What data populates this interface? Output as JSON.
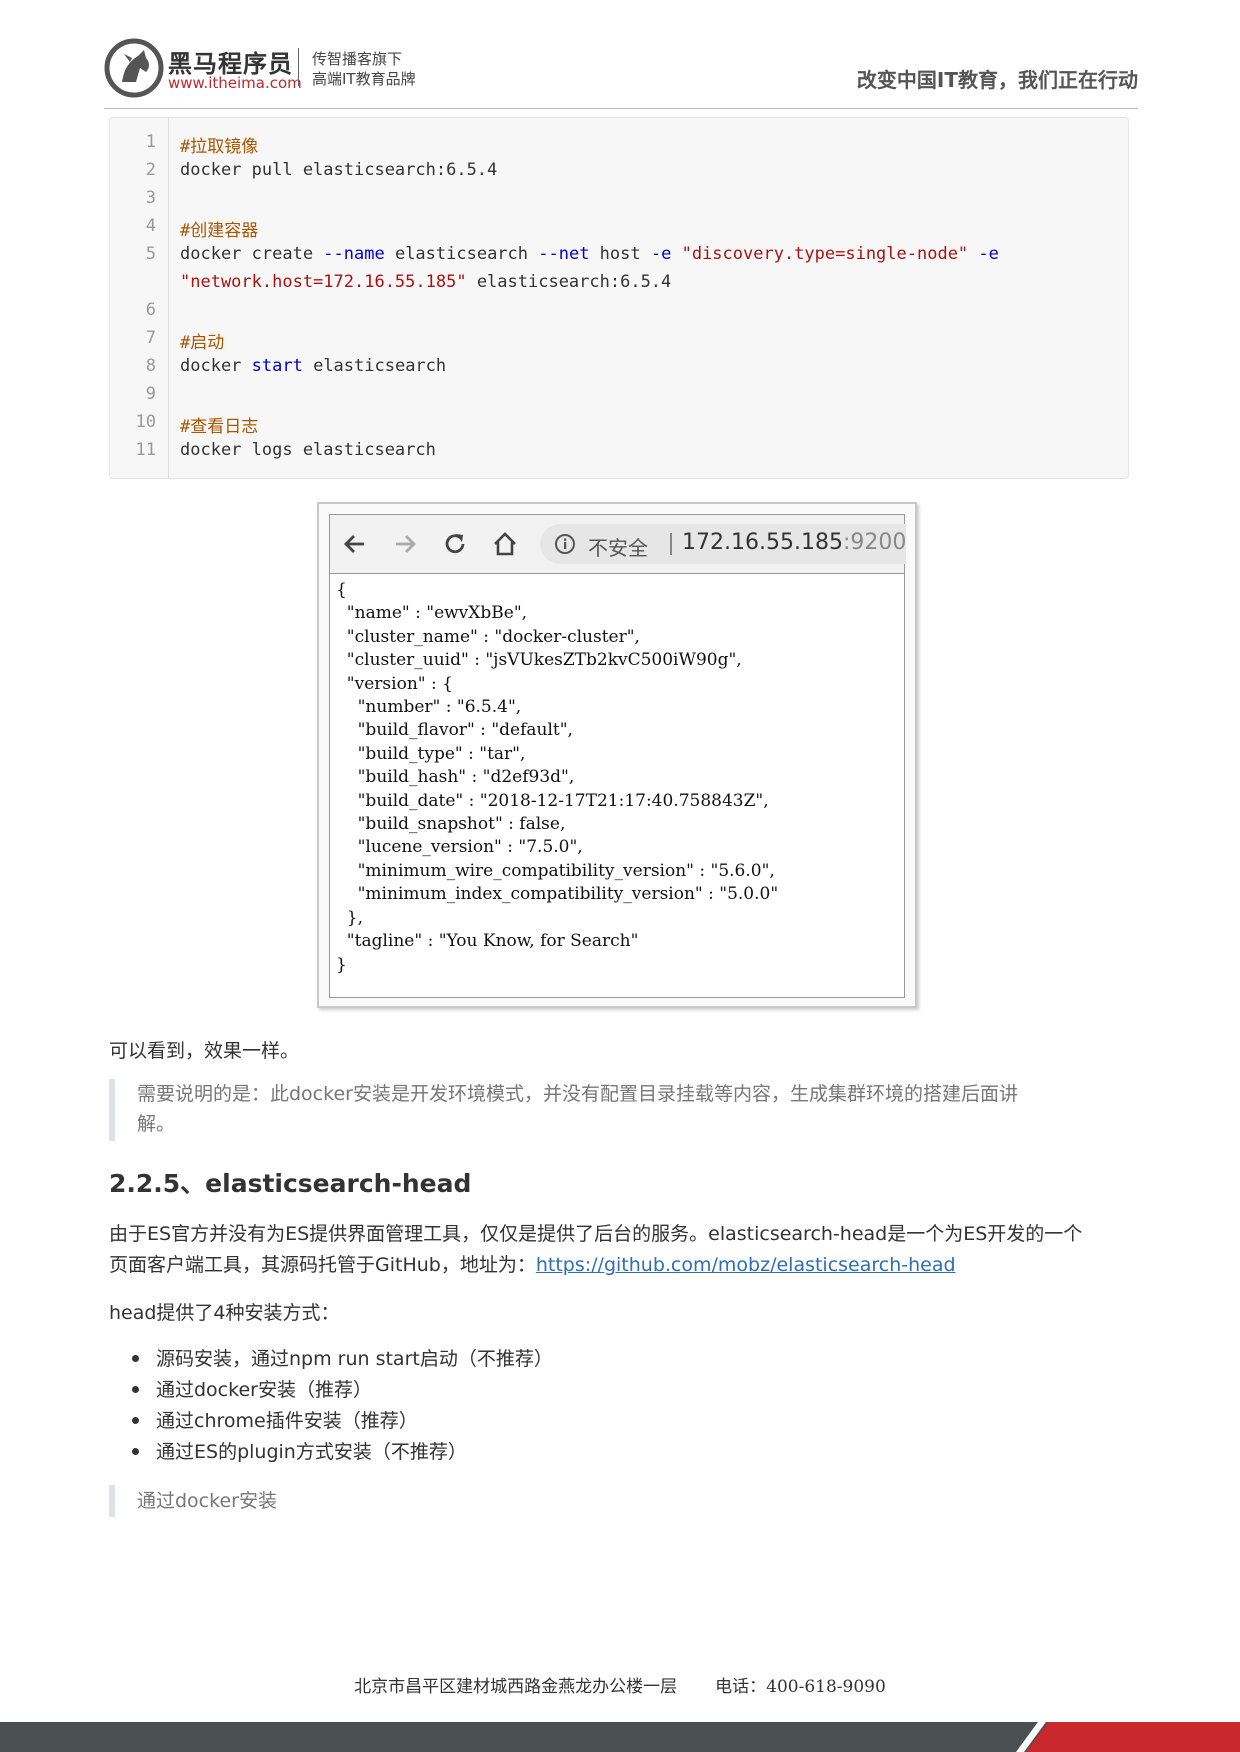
{
  "header": {
    "brand_name": "黑马程序员",
    "brand_url": "www.itheima.com",
    "tagline_line1": "传智播客旗下",
    "tagline_line2": "高端IT教育品牌",
    "slogan": "改变中国IT教育，我们正在行动"
  },
  "code": {
    "line_numbers": [
      "1",
      "2",
      "3",
      "4",
      "5",
      "6",
      "7",
      "8",
      "9",
      "10",
      "11"
    ],
    "c1": "#拉取镜像",
    "c2": "docker pull elasticsearch:6.5.4",
    "c4": "#创建容器",
    "c5a": "docker create ",
    "c5b": "--name",
    "c5c": " elasticsearch ",
    "c5d": "--net",
    "c5e": " host ",
    "c5f": "-e",
    "c5g": " ",
    "c5h": "\"discovery.type=single-node\"",
    "c5i": " ",
    "c5j": "-e",
    "c5k": "\"network.host=172.16.55.185\"",
    "c5l": " elasticsearch:6.5.4",
    "c7": "#启动",
    "c8a": "docker ",
    "c8b": "start",
    "c8c": " elasticsearch",
    "c10": "#查看日志",
    "c11": "docker logs elasticsearch"
  },
  "browser": {
    "insecure_label": "不安全",
    "host": "172.16.55.185",
    "port": ":9200",
    "json_lines": [
      "{",
      "  \"name\" : \"ewvXbBe\",",
      "  \"cluster_name\" : \"docker-cluster\",",
      "  \"cluster_uuid\" : \"jsVUkesZTb2kvC500iW90g\",",
      "  \"version\" : {",
      "    \"number\" : \"6.5.4\",",
      "    \"build_flavor\" : \"default\",",
      "    \"build_type\" : \"tar\",",
      "    \"build_hash\" : \"d2ef93d\",",
      "    \"build_date\" : \"2018-12-17T21:17:40.758843Z\",",
      "    \"build_snapshot\" : false,",
      "    \"lucene_version\" : \"7.5.0\",",
      "    \"minimum_wire_compatibility_version\" : \"5.6.0\",",
      "    \"minimum_index_compatibility_version\" : \"5.0.0\"",
      "  },",
      "  \"tagline\" : \"You Know, for Search\"",
      "}"
    ]
  },
  "content": {
    "p1": "可以看到，效果一样。",
    "note_line1": "需要说明的是：此docker安装是开发环境模式，并没有配置目录挂载等内容，生成集群环境的搭建后面讲",
    "note_line2": "解。",
    "heading": "2.2.5、elasticsearch-head",
    "p2_line1": "由于ES官方并没有为ES提供界面管理工具，仅仅是提供了后台的服务。elasticsearch-head是一个为ES开发的一个",
    "p2_line2": "页面客户端工具，其源码托管于GitHub，地址为：",
    "p2_link": "https://github.com/mobz/elasticsearch-head",
    "p3": "head提供了4种安装方式：",
    "list": [
      "源码安装，通过npm run start启动（不推荐）",
      "通过docker安装（推荐）",
      "通过chrome插件安装（推荐）",
      "通过ES的plugin方式安装（不推荐）"
    ],
    "note2": "通过docker安装"
  },
  "footer": {
    "address": "北京市昌平区建材城西路金燕龙办公楼一层",
    "phone": "电话：400-618-9090"
  }
}
